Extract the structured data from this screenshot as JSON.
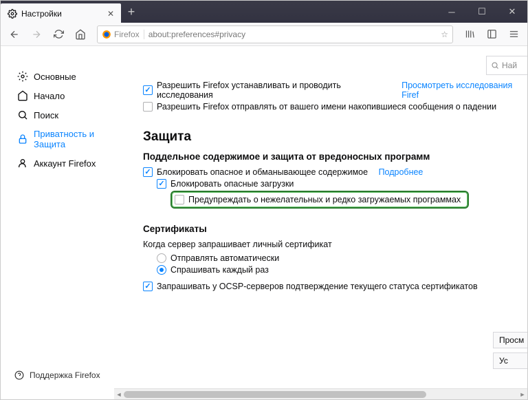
{
  "window": {
    "tab_title": "Настройки"
  },
  "urlbar": {
    "identity": "Firefox",
    "address": "about:preferences#privacy"
  },
  "sidebar": {
    "items": [
      {
        "label": "Основные"
      },
      {
        "label": "Начало"
      },
      {
        "label": "Поиск"
      },
      {
        "label": "Приватность и Защита"
      },
      {
        "label": "Аккаунт Firefox"
      }
    ],
    "support": "Поддержка Firefox"
  },
  "search_placeholder": "Най",
  "checkboxes": {
    "allow_studies": "Разрешить Firefox устанавливать и проводить исследования",
    "studies_link": "Просмотреть исследования Firef",
    "send_crash": "Разрешить Firefox отправлять от вашего имени накопившиеся сообщения о падении"
  },
  "security": {
    "heading": "Защита",
    "sub1": "Поддельное содержимое и защита от вредоносных программ",
    "block_deceptive": "Блокировать опасное и обманывающее содержимое",
    "learn_more": "Подробнее",
    "block_downloads": "Блокировать опасные загрузки",
    "warn_unwanted": "Предупреждать о нежелательных и редко загружаемых программах"
  },
  "certs": {
    "heading": "Сертификаты",
    "intro": "Когда сервер запрашивает личный сертификат",
    "auto": "Отправлять автоматически",
    "ask": "Спрашивать каждый раз",
    "ocsp": "Запрашивать у OCSP-серверов подтверждение текущего статуса сертификатов"
  },
  "buttons": {
    "view": "Просм",
    "devices": "Ус"
  }
}
